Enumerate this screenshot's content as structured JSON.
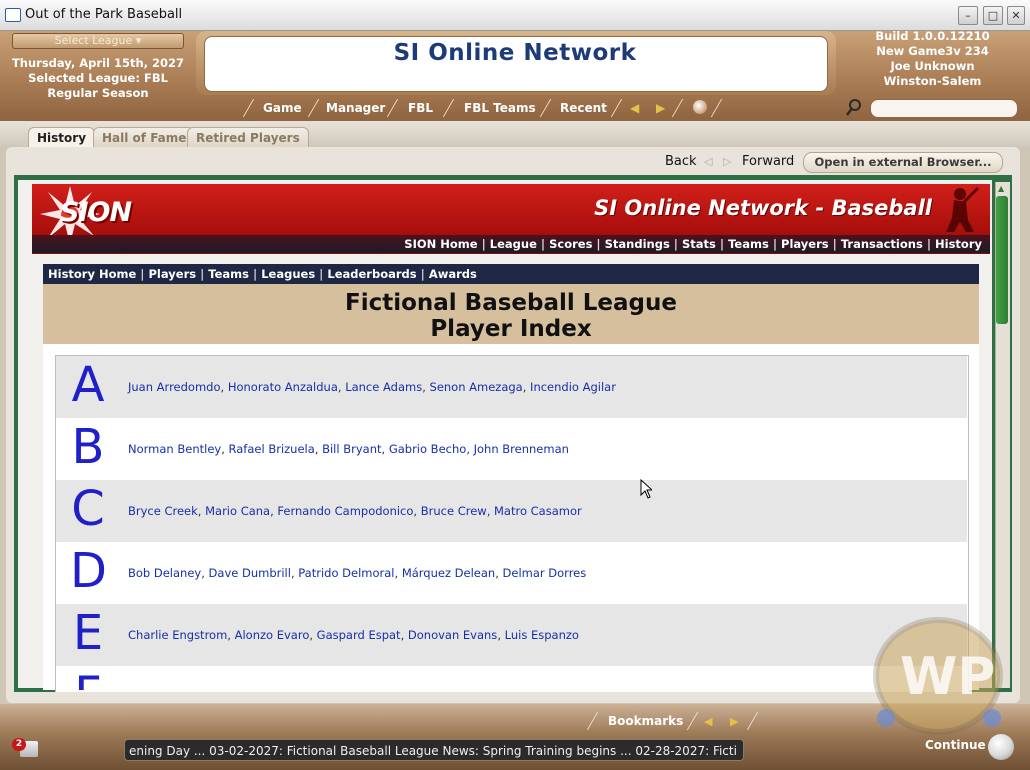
{
  "window": {
    "title": "Out of the Park Baseball"
  },
  "header": {
    "league_select": "Select League",
    "date": "Thursday, April 15th, 2027",
    "selected_league": "Selected League: FBL",
    "season": "Regular Season",
    "network_title": "SI Online Network",
    "build": "Build 1.0.0.12210",
    "game": "New Game3v 234",
    "user": "Joe Unknown",
    "team": "Winston-Salem"
  },
  "nav": {
    "items": [
      {
        "label": "Game"
      },
      {
        "label": "Manager"
      },
      {
        "label": "FBL"
      },
      {
        "label": "FBL Teams"
      },
      {
        "label": "Recent"
      }
    ]
  },
  "tabs": [
    {
      "label": "History",
      "active": true
    },
    {
      "label": "Hall of Fame",
      "active": false
    },
    {
      "label": "Retired Players",
      "active": false
    }
  ],
  "browser": {
    "back": "Back",
    "forward": "Forward",
    "external": "Open in external Browser..."
  },
  "sion": {
    "logo": "SION",
    "banner_title": "SI Online Network - Baseball",
    "nav": [
      "SION Home",
      "League",
      "Scores",
      "Standings",
      "Stats",
      "Teams",
      "Players",
      "Transactions",
      "History"
    ]
  },
  "history_nav": [
    "History Home",
    "Players",
    "Teams",
    "Leagues",
    "Leaderboards",
    "Awards"
  ],
  "page": {
    "title_line1": "Fictional Baseball League",
    "title_line2": "Player Index"
  },
  "index": [
    {
      "letter": "A",
      "names": [
        "Juan Arredomdo",
        "Honorato Anzaldua",
        "Lance Adams",
        "Senon Amezaga",
        "Incendio Agilar"
      ]
    },
    {
      "letter": "B",
      "names": [
        "Norman Bentley",
        "Rafael Brizuela",
        "Bill Bryant",
        "Gabrio Becho",
        "John Brenneman"
      ]
    },
    {
      "letter": "C",
      "names": [
        "Bryce Creek",
        "Mario Cana",
        "Fernando Campodonico",
        "Bruce Crew",
        "Matro Casamor"
      ]
    },
    {
      "letter": "D",
      "names": [
        "Bob Delaney",
        "Dave Dumbrill",
        "Patrido Delmoral",
        "Márquez Delean",
        "Delmar Dorres"
      ]
    },
    {
      "letter": "E",
      "names": [
        "Charlie Engstrom",
        "Alonzo Evaro",
        "Gaspard Espat",
        "Donovan Evans",
        "Luis Espanzo"
      ]
    },
    {
      "letter": "F",
      "names": []
    }
  ],
  "bottom": {
    "bookmarks": "Bookmarks",
    "ticker": "ening Day ... 03-02-2027: Fictional Baseball League News: Spring Training begins ... 02-28-2027: Ficti",
    "continue": "Continue",
    "notification_count": "2"
  },
  "colors": {
    "header_brown": "#a77a52",
    "sion_red": "#c4140f",
    "nav_navy": "#1e2744",
    "title_tan": "#d6bf9c",
    "letter_blue": "#2020c8",
    "link_blue": "#1630a8",
    "scroll_green": "#3a9a3f"
  }
}
